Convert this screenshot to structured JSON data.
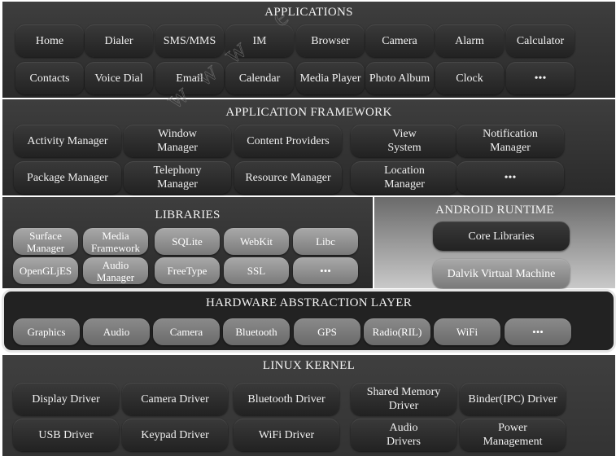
{
  "applications": {
    "title": "APPLICATIONS",
    "items": [
      "Home",
      "Dialer",
      "SMS/MMS",
      "IM",
      "Browser",
      "Camera",
      "Alarm",
      "Calculator",
      "Contacts",
      "Voice Dial",
      "Email",
      "Calendar",
      "Media Player",
      "Photo Album",
      "Clock",
      "•••"
    ]
  },
  "framework": {
    "title": "APPLICATION FRAMEWORK",
    "items": [
      "Activity Manager",
      "Window\nManager",
      "Content Providers",
      "View\nSystem",
      "Notification\nManager",
      "Package Manager",
      "Telephony\nManager",
      "Resource Manager",
      "Location\nManager",
      "•••"
    ]
  },
  "libraries": {
    "title": "LIBRARIES",
    "items": [
      "Surface\nManager",
      "Media\nFramework",
      "SQLite",
      "WebKit",
      "Libc",
      "OpenGLjES",
      "Audio\nManager",
      "FreeType",
      "SSL",
      "•••"
    ]
  },
  "runtime": {
    "title": "ANDROID RUNTIME",
    "items": [
      "Core Libraries",
      "Dalvik Virtual Machine"
    ]
  },
  "hal": {
    "title": "HARDWARE ABSTRACTION LAYER",
    "items": [
      "Graphics",
      "Audio",
      "Camera",
      "Bluetooth",
      "GPS",
      "Radio(RIL)",
      "WiFi",
      "•••"
    ]
  },
  "kernel": {
    "title": "LINUX KERNEL",
    "items": [
      "Display Driver",
      "Camera Driver",
      "Bluetooth Driver",
      "Shared Memory\nDriver",
      "Binder(IPC) Driver",
      "USB Driver",
      "Keypad Driver",
      "WiFi Driver",
      "Audio\nDrivers",
      "Power\nManagement"
    ]
  },
  "watermark": "w w w . e"
}
